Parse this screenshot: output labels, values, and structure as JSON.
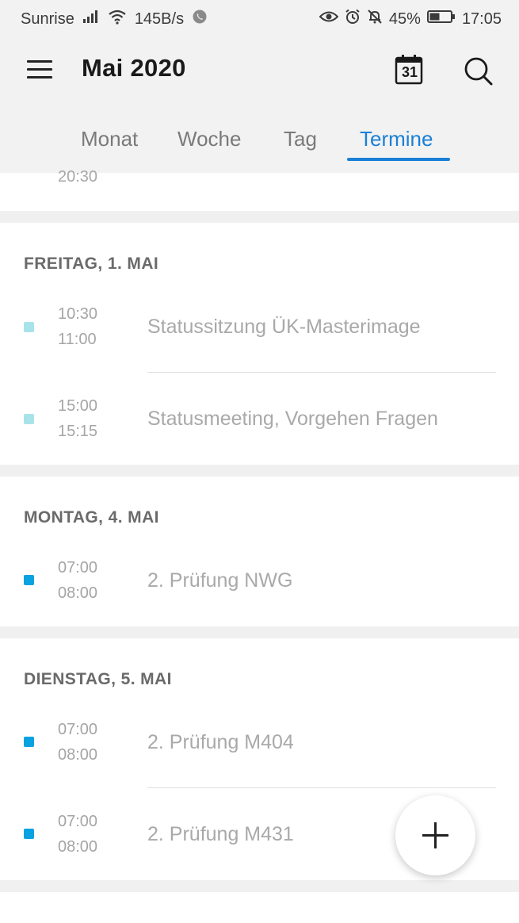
{
  "status_bar": {
    "carrier": "Sunrise",
    "speed": "145B/s",
    "battery": "45%",
    "time": "17:05",
    "icons": [
      "signal-icon",
      "wifi-icon",
      "whatsapp-icon",
      "eye-icon",
      "alarm-icon",
      "bell-off-icon",
      "battery-icon"
    ]
  },
  "header": {
    "title": "Mai 2020",
    "calendar_day": "31"
  },
  "tabs": [
    {
      "label": "Monat",
      "active": false
    },
    {
      "label": "Woche",
      "active": false
    },
    {
      "label": "Tag",
      "active": false
    },
    {
      "label": "Termine",
      "active": true
    }
  ],
  "partial_event": {
    "end_time": "20:30"
  },
  "days": [
    {
      "header": "FREITAG, 1. MAI",
      "events": [
        {
          "start": "10:30",
          "end": "11:00",
          "title": "Statussitzung ÜK-Masterimage",
          "color": "#a8e3ea"
        },
        {
          "start": "15:00",
          "end": "15:15",
          "title": "Statusmeeting, Vorgehen Fragen",
          "color": "#a8e3ea"
        }
      ]
    },
    {
      "header": "MONTAG, 4. MAI",
      "events": [
        {
          "start": "07:00",
          "end": "08:00",
          "title": "2. Prüfung NWG",
          "color": "#0aa2e0"
        }
      ]
    },
    {
      "header": "DIENSTAG, 5. MAI",
      "events": [
        {
          "start": "07:00",
          "end": "08:00",
          "title": "2. Prüfung M404",
          "color": "#0aa2e0"
        },
        {
          "start": "07:00",
          "end": "08:00",
          "title": "2. Prüfung M431",
          "color": "#0aa2e0"
        }
      ]
    }
  ],
  "colors": {
    "accent": "#1a7fd6",
    "light_event": "#a8e3ea",
    "exam_event": "#0aa2e0"
  }
}
